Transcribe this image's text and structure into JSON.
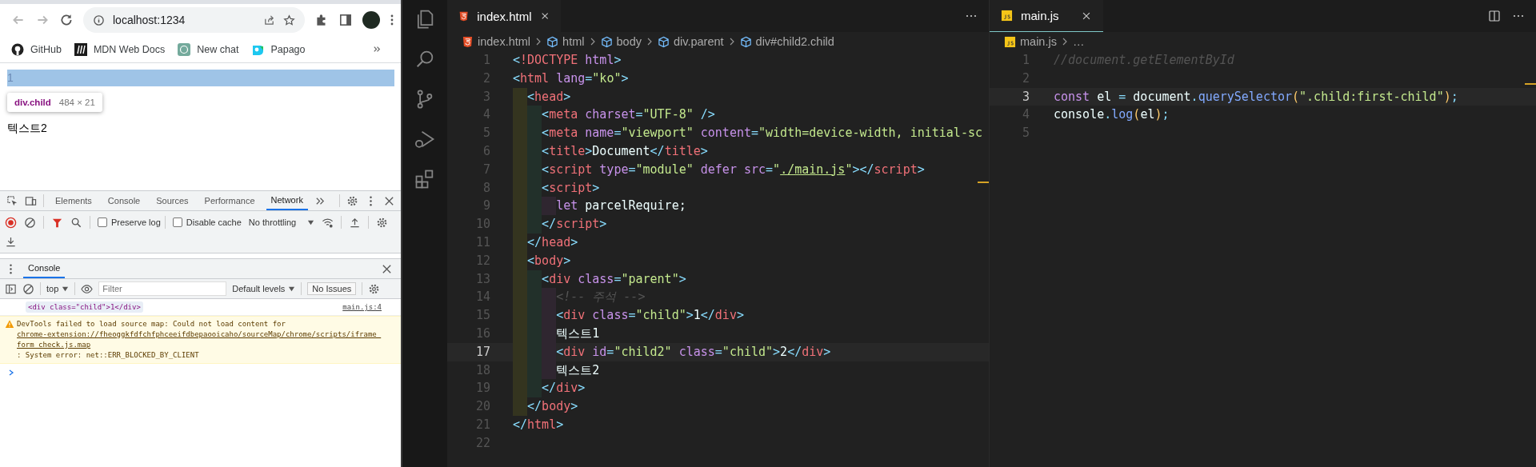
{
  "browser": {
    "address": "localhost:1234",
    "bookmarks": [
      {
        "label": "GitHub",
        "kind": "github"
      },
      {
        "label": "MDN Web Docs",
        "kind": "mdn"
      },
      {
        "label": "New chat",
        "kind": "chat"
      },
      {
        "label": "Papago",
        "kind": "papago"
      }
    ],
    "page": {
      "lines": [
        {
          "text": "1",
          "highlighted": true
        },
        {
          "text": "텍스트2",
          "highlighted": false
        }
      ],
      "tooltip": {
        "selector": "div.child",
        "size": "484 × 21"
      }
    }
  },
  "devtools": {
    "tabs": [
      {
        "label": "Elements",
        "selected": false
      },
      {
        "label": "Console",
        "selected": false
      },
      {
        "label": "Sources",
        "selected": false
      },
      {
        "label": "Performance",
        "selected": false
      },
      {
        "label": "Network",
        "selected": true
      }
    ],
    "network_toolbar": {
      "recording": true,
      "filter_active": true,
      "options": [
        {
          "label": "Preserve log",
          "checked": false
        },
        {
          "label": "Disable cache",
          "checked": false
        }
      ],
      "throttling": "No throttling"
    },
    "drawer": {
      "tabs": [
        {
          "label": "Console",
          "selected": true
        }
      ],
      "context": "top",
      "filter_placeholder": "Filter",
      "levels": "Default levels",
      "issues": "No Issues",
      "messages": [
        {
          "kind": "log",
          "text": "<div class=\"child\">1</div>",
          "source": "main.js:4"
        },
        {
          "kind": "warning",
          "text": "DevTools failed to load source map: Could not load content for",
          "link": "chrome-extension://fheoggkfdfchfphceeifdbepaooicaho/sourceMap/chrome/scripts/iframe_form_check.js.map",
          "after": ": System error: net::ERR_BLOCKED_BY_CLIENT"
        }
      ]
    }
  },
  "editor": {
    "panes": [
      {
        "focused": false,
        "tab": {
          "label": "index.html",
          "kind": "html"
        },
        "breadcrumbs": [
          {
            "label": "index.html",
            "kind": "html"
          },
          {
            "label": "html",
            "kind": "element"
          },
          {
            "label": "body",
            "kind": "element"
          },
          {
            "label": "div.parent",
            "kind": "element"
          },
          {
            "label": "div#child2.child",
            "kind": "element"
          }
        ],
        "lines": [
          {
            "number": "1",
            "current": false,
            "tokens": [
              {
                "kind": "punct",
                "text": "<"
              },
              {
                "kind": "tag",
                "text": "!DOCTYPE"
              },
              {
                "kind": "attr",
                "text": " html"
              },
              {
                "kind": "punct",
                "text": ">"
              }
            ]
          },
          {
            "number": "2",
            "current": false,
            "tokens": [
              {
                "kind": "punct",
                "text": "<"
              },
              {
                "kind": "tag",
                "text": "html"
              },
              {
                "kind": "attr",
                "text": " lang"
              },
              {
                "kind": "op",
                "text": "="
              },
              {
                "kind": "string",
                "text": "\"ko\""
              },
              {
                "kind": "punct",
                "text": ">"
              }
            ]
          },
          {
            "number": "3",
            "current": false,
            "tokens": [
              {
                "kind": "punct",
                "text": "  <"
              },
              {
                "kind": "tag",
                "text": "head"
              },
              {
                "kind": "punct",
                "text": ">"
              }
            ]
          },
          {
            "number": "4",
            "current": false,
            "tokens": [
              {
                "kind": "punct",
                "text": "    <"
              },
              {
                "kind": "tag",
                "text": "meta"
              },
              {
                "kind": "attr",
                "text": " charset"
              },
              {
                "kind": "op",
                "text": "="
              },
              {
                "kind": "string",
                "text": "\"UTF-8\""
              },
              {
                "kind": "punct",
                "text": " />"
              }
            ]
          },
          {
            "number": "5",
            "current": false,
            "tokens": [
              {
                "kind": "punct",
                "text": "    <"
              },
              {
                "kind": "tag",
                "text": "meta"
              },
              {
                "kind": "attr",
                "text": " name"
              },
              {
                "kind": "op",
                "text": "="
              },
              {
                "kind": "string",
                "text": "\"viewport\""
              },
              {
                "kind": "attr",
                "text": " content"
              },
              {
                "kind": "op",
                "text": "="
              },
              {
                "kind": "string",
                "text": "\"width=device-width, initial-sc"
              }
            ]
          },
          {
            "number": "6",
            "current": false,
            "tokens": [
              {
                "kind": "punct",
                "text": "    <"
              },
              {
                "kind": "tag",
                "text": "title"
              },
              {
                "kind": "punct",
                "text": ">"
              },
              {
                "kind": "text",
                "text": "Document"
              },
              {
                "kind": "punct",
                "text": "</"
              },
              {
                "kind": "tag",
                "text": "title"
              },
              {
                "kind": "punct",
                "text": ">"
              }
            ]
          },
          {
            "number": "7",
            "current": false,
            "tokens": [
              {
                "kind": "punct",
                "text": "    <"
              },
              {
                "kind": "tag",
                "text": "script"
              },
              {
                "kind": "attr",
                "text": " type"
              },
              {
                "kind": "op",
                "text": "="
              },
              {
                "kind": "string",
                "text": "\"module\""
              },
              {
                "kind": "attr",
                "text": " defer src"
              },
              {
                "kind": "op",
                "text": "="
              },
              {
                "kind": "string",
                "text": "\""
              },
              {
                "kind": "link",
                "text": "./main.js"
              },
              {
                "kind": "string",
                "text": "\""
              },
              {
                "kind": "punct",
                "text": "></"
              },
              {
                "kind": "tag",
                "text": "script"
              },
              {
                "kind": "punct",
                "text": ">"
              }
            ]
          },
          {
            "number": "8",
            "current": false,
            "tokens": [
              {
                "kind": "punct",
                "text": "    <"
              },
              {
                "kind": "tag",
                "text": "script"
              },
              {
                "kind": "punct",
                "text": ">"
              }
            ]
          },
          {
            "number": "9",
            "current": false,
            "tokens": [
              {
                "kind": "keyword",
                "text": "      let"
              },
              {
                "kind": "text",
                "text": " parcelRequire;"
              }
            ]
          },
          {
            "number": "10",
            "current": false,
            "tokens": [
              {
                "kind": "punct",
                "text": "    </"
              },
              {
                "kind": "tag",
                "text": "script"
              },
              {
                "kind": "punct",
                "text": ">"
              }
            ]
          },
          {
            "number": "11",
            "current": false,
            "tokens": [
              {
                "kind": "punct",
                "text": "  </"
              },
              {
                "kind": "tag",
                "text": "head"
              },
              {
                "kind": "punct",
                "text": ">"
              }
            ]
          },
          {
            "number": "12",
            "current": false,
            "tokens": [
              {
                "kind": "punct",
                "text": "  <"
              },
              {
                "kind": "tag",
                "text": "body"
              },
              {
                "kind": "punct",
                "text": ">"
              }
            ]
          },
          {
            "number": "13",
            "current": false,
            "tokens": [
              {
                "kind": "punct",
                "text": "    <"
              },
              {
                "kind": "tag",
                "text": "div"
              },
              {
                "kind": "attr",
                "text": " class"
              },
              {
                "kind": "op",
                "text": "="
              },
              {
                "kind": "string",
                "text": "\"parent\""
              },
              {
                "kind": "punct",
                "text": ">"
              }
            ]
          },
          {
            "number": "14",
            "current": false,
            "tokens": [
              {
                "kind": "comment",
                "text": "      <!-- 주석 -->"
              }
            ]
          },
          {
            "number": "15",
            "current": false,
            "tokens": [
              {
                "kind": "punct",
                "text": "      <"
              },
              {
                "kind": "tag",
                "text": "div"
              },
              {
                "kind": "attr",
                "text": " class"
              },
              {
                "kind": "op",
                "text": "="
              },
              {
                "kind": "string",
                "text": "\"child\""
              },
              {
                "kind": "punct",
                "text": ">"
              },
              {
                "kind": "text",
                "text": "1"
              },
              {
                "kind": "punct",
                "text": "</"
              },
              {
                "kind": "tag",
                "text": "div"
              },
              {
                "kind": "punct",
                "text": ">"
              }
            ]
          },
          {
            "number": "16",
            "current": false,
            "tokens": [
              {
                "kind": "text",
                "text": "      텍스트1"
              }
            ]
          },
          {
            "number": "17",
            "current": true,
            "tokens": [
              {
                "kind": "punct",
                "text": "      <"
              },
              {
                "kind": "tag",
                "text": "div"
              },
              {
                "kind": "attr",
                "text": " id"
              },
              {
                "kind": "op",
                "text": "="
              },
              {
                "kind": "string",
                "text": "\"child2\""
              },
              {
                "kind": "attr",
                "text": " class"
              },
              {
                "kind": "op",
                "text": "="
              },
              {
                "kind": "string",
                "text": "\"child\""
              },
              {
                "kind": "punct",
                "text": ">"
              },
              {
                "kind": "text",
                "text": "2"
              },
              {
                "kind": "punct",
                "text": "</"
              },
              {
                "kind": "tag",
                "text": "div"
              },
              {
                "kind": "punct",
                "text": ">"
              }
            ]
          },
          {
            "number": "18",
            "current": false,
            "tokens": [
              {
                "kind": "text",
                "text": "      텍스트2"
              }
            ]
          },
          {
            "number": "19",
            "current": false,
            "tokens": [
              {
                "kind": "punct",
                "text": "    </"
              },
              {
                "kind": "tag",
                "text": "div"
              },
              {
                "kind": "punct",
                "text": ">"
              }
            ]
          },
          {
            "number": "20",
            "current": false,
            "tokens": [
              {
                "kind": "punct",
                "text": "  </"
              },
              {
                "kind": "tag",
                "text": "body"
              },
              {
                "kind": "punct",
                "text": ">"
              }
            ]
          },
          {
            "number": "21",
            "current": false,
            "tokens": [
              {
                "kind": "punct",
                "text": "</"
              },
              {
                "kind": "tag",
                "text": "html"
              },
              {
                "kind": "punct",
                "text": ">"
              }
            ]
          },
          {
            "number": "22",
            "current": false
          }
        ]
      },
      {
        "focused": true,
        "tab": {
          "label": "main.js",
          "kind": "js"
        },
        "breadcrumbs": [
          {
            "label": "main.js",
            "kind": "js"
          },
          {
            "label": "…",
            "kind": "more"
          }
        ],
        "lines": [
          {
            "number": "1",
            "current": false,
            "tokens": [
              {
                "kind": "comment",
                "text": "//document.getElementById"
              }
            ]
          },
          {
            "number": "2",
            "current": false
          },
          {
            "number": "3",
            "current": true,
            "tokens": [
              {
                "kind": "keyword",
                "text": "const"
              },
              {
                "kind": "text",
                "text": " el "
              },
              {
                "kind": "op",
                "text": "="
              },
              {
                "kind": "text",
                "text": " document"
              },
              {
                "kind": "op",
                "text": "."
              },
              {
                "kind": "func",
                "text": "querySelector"
              },
              {
                "kind": "paren",
                "text": "("
              },
              {
                "kind": "string",
                "text": "\".child:first-child\""
              },
              {
                "kind": "paren",
                "text": ")"
              },
              {
                "kind": "op",
                "text": ";"
              }
            ]
          },
          {
            "number": "4",
            "current": false,
            "tokens": [
              {
                "kind": "text",
                "text": "console"
              },
              {
                "kind": "op",
                "text": "."
              },
              {
                "kind": "func",
                "text": "log"
              },
              {
                "kind": "paren",
                "text": "("
              },
              {
                "kind": "text",
                "text": "el"
              },
              {
                "kind": "paren",
                "text": ")"
              },
              {
                "kind": "op",
                "text": ";"
              }
            ]
          },
          {
            "number": "5",
            "current": false
          }
        ]
      }
    ]
  }
}
